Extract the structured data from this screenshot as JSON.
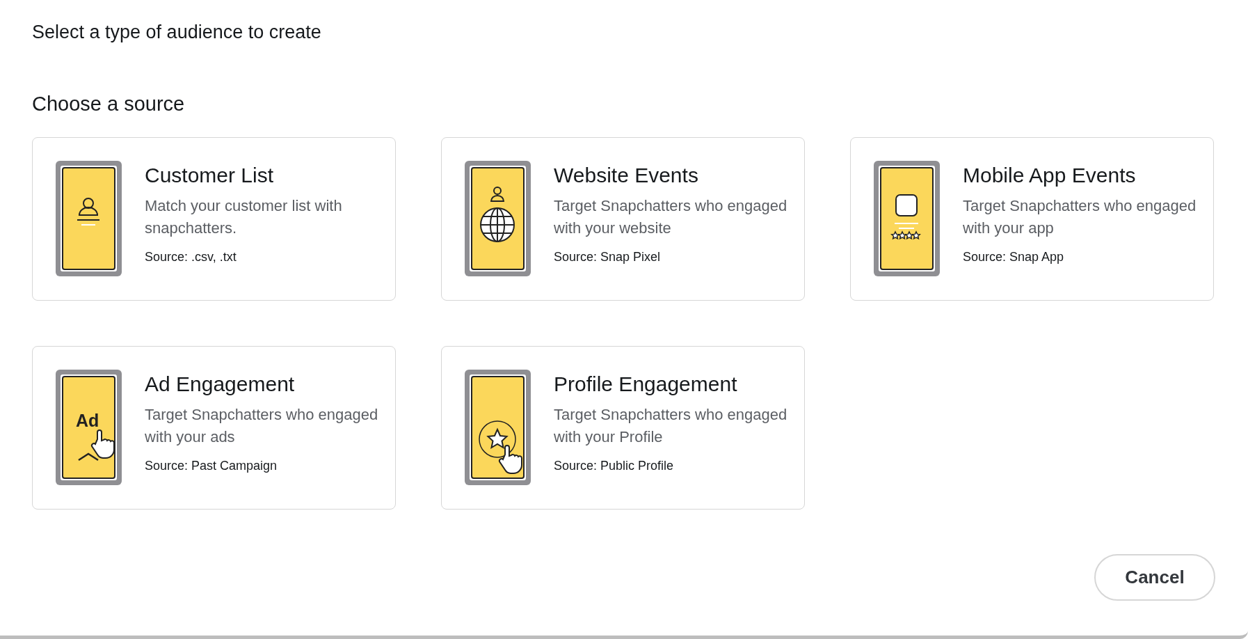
{
  "dialog": {
    "title": "Select a type of audience to create",
    "section_title": "Choose a source",
    "sources": [
      {
        "kind": "customer-list",
        "title": "Customer List",
        "description": "Match your customer list with snapchatters.",
        "source": "Source: .csv, .txt"
      },
      {
        "kind": "website",
        "title": "Website Events",
        "description": "Target Snapchatters who engaged with your website",
        "source": "Source: Snap Pixel"
      },
      {
        "kind": "mobile-app",
        "title": "Mobile App Events",
        "description": "Target Snapchatters who engaged with your app",
        "source": "Source: Snap App"
      },
      {
        "kind": "ad",
        "title": "Ad Engagement",
        "description": "Target Snapchatters who engaged with your ads",
        "source": "Source: Past Campaign",
        "illustration_text": "Ad"
      },
      {
        "kind": "profile",
        "title": "Profile Engagement",
        "description": "Target Snapchatters who engaged with your Profile",
        "source": "Source: Public Profile"
      }
    ],
    "buttons": [
      "Cancel"
    ]
  }
}
